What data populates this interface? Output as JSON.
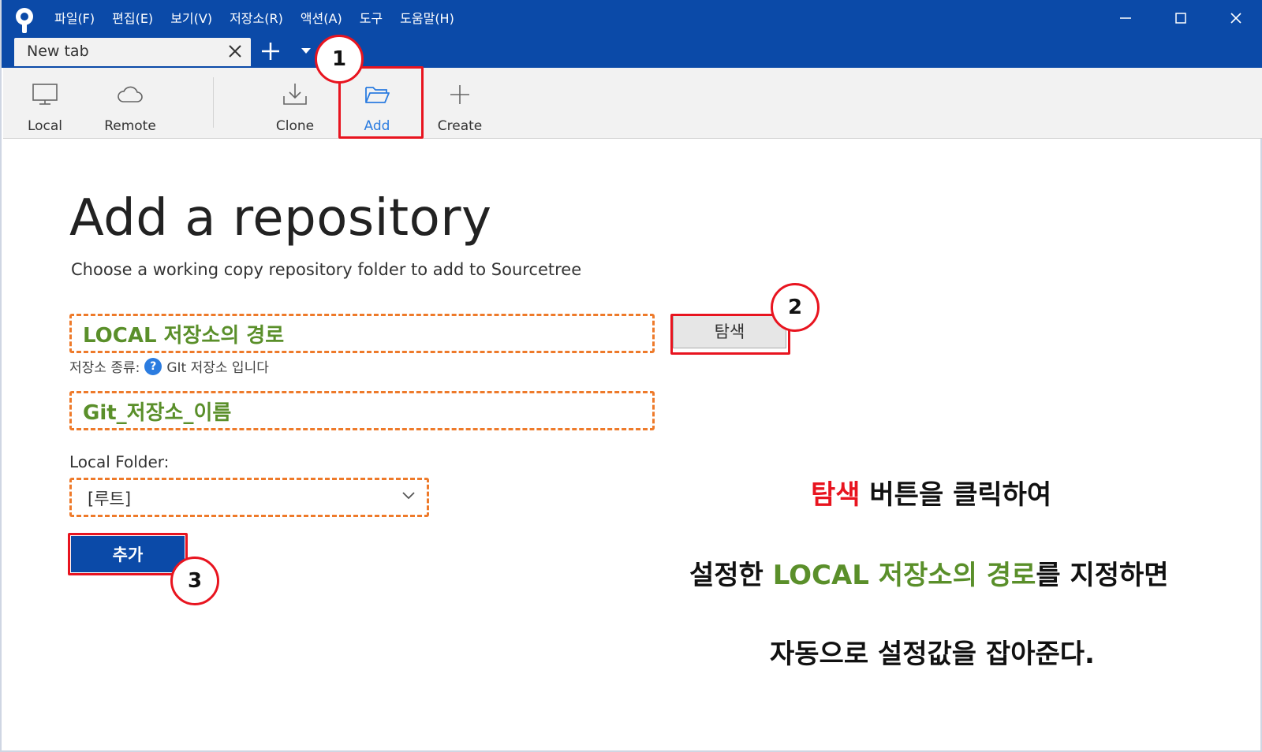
{
  "menu": [
    "파일(F)",
    "편집(E)",
    "보기(V)",
    "저장소(R)",
    "액션(A)",
    "도구",
    "도움말(H)"
  ],
  "tab": {
    "label": "New tab"
  },
  "toolbar": {
    "local": "Local",
    "remote": "Remote",
    "clone": "Clone",
    "add": "Add",
    "create": "Create"
  },
  "main": {
    "title": "Add a repository",
    "subtitle": "Choose a working copy repository folder to add to Sourcetree",
    "path_value": "LOCAL 저장소의 경로",
    "browse_label": "탐색",
    "repo_type_prefix": "저장소 종류:",
    "repo_type_value": "GIt 저장소 입니다",
    "name_value": "Git_저장소_이름",
    "folder_label": "Local Folder:",
    "folder_value": "[루트]",
    "add_button": "추가"
  },
  "steps": [
    "1",
    "2",
    "3"
  ],
  "annotation": {
    "line1_red": "탐색",
    "line1_rest": " 버튼을 클릭하여",
    "line2_a": "설정한 ",
    "line2_green": "LOCAL 저장소의 경로",
    "line2_b": "를 지정하면",
    "line3": "자동으로 설정값을 잡아준다."
  },
  "colors": {
    "titlebar": "#0b4aa8",
    "highlight_red": "#e8141f",
    "field_orange": "#ee7a2a",
    "green_text": "#5a8f2a",
    "active_blue": "#2b7ce0"
  }
}
